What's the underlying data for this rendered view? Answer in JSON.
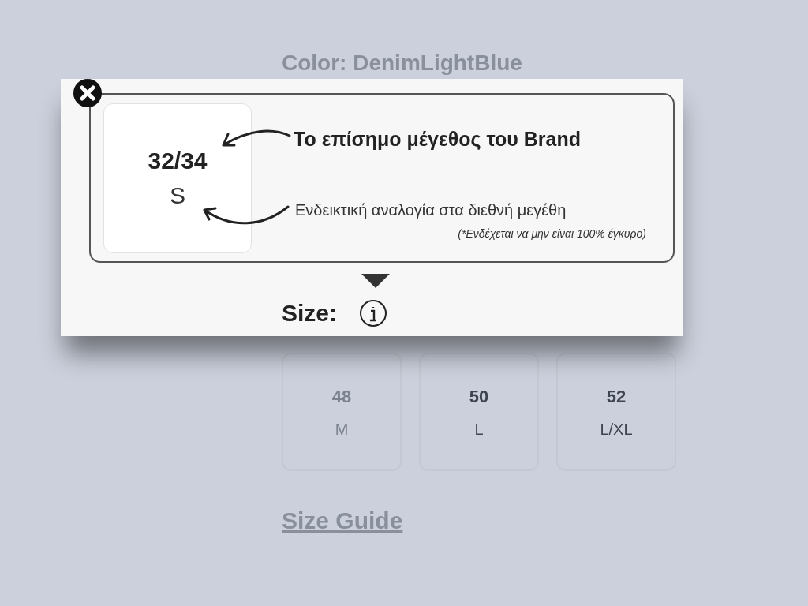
{
  "background": {
    "color_label": "Color: DenimLightBlue",
    "size_options": [
      {
        "size": "48",
        "international": "M",
        "disabled": true
      },
      {
        "size": "50",
        "international": "L",
        "disabled": false
      },
      {
        "size": "52",
        "international": "L/XL",
        "disabled": false
      }
    ],
    "size_guide_link": "Size Guide"
  },
  "popup": {
    "example_size": "32/34",
    "example_international": "S",
    "brand_note": "Το επίσημο μέγεθος του Brand",
    "international_note": "Ενδεικτική αναλογία στα διεθνή μεγέθη",
    "disclaimer": "(*Ενδέχεται να μην είναι 100% έγκυρο)",
    "size_label": "Size:"
  }
}
